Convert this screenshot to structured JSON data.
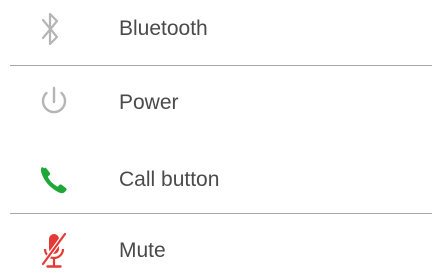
{
  "items": [
    {
      "label": "Bluetooth",
      "icon": "bluetooth-icon",
      "icon_color": "#b5b5b5"
    },
    {
      "label": "Power",
      "icon": "power-icon",
      "icon_color": "#b5b5b5"
    },
    {
      "label": "Call button",
      "icon": "phone-icon",
      "icon_color": "#1ea83a"
    },
    {
      "label": "Mute",
      "icon": "microphone-muted-icon",
      "icon_color": "#e53935"
    }
  ]
}
